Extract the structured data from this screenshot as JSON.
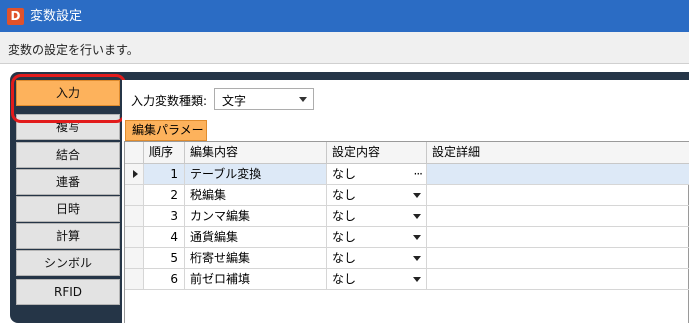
{
  "window": {
    "app_icon_letter": "D",
    "title": "変数設定"
  },
  "message": "変数の設定を行います。",
  "nav": {
    "items": [
      "入力",
      "複写",
      "結合",
      "連番",
      "日時",
      "計算",
      "シンボル",
      "RFID"
    ],
    "active": "入力"
  },
  "input_type": {
    "label": "入力変数種類:",
    "value": "文字"
  },
  "tab_label": "編集パラメータ",
  "grid": {
    "headers": [
      "順序",
      "編集内容",
      "設定内容",
      "設定詳細"
    ],
    "rows": [
      {
        "order": "1",
        "edit": "テーブル変換",
        "setting": "なし",
        "detail": ""
      },
      {
        "order": "2",
        "edit": "税編集",
        "setting": "なし",
        "detail": ""
      },
      {
        "order": "3",
        "edit": "カンマ編集",
        "setting": "なし",
        "detail": ""
      },
      {
        "order": "4",
        "edit": "通貨編集",
        "setting": "なし",
        "detail": ""
      },
      {
        "order": "5",
        "edit": "桁寄せ編集",
        "setting": "なし",
        "detail": ""
      },
      {
        "order": "6",
        "edit": "前ゼロ補填",
        "setting": "なし",
        "detail": ""
      }
    ],
    "ellipsis": "···"
  },
  "colors": {
    "titlebar": "#2b6cc4",
    "accent_orange": "#fdb25c",
    "dark_panel": "#253547",
    "highlight_red": "#e21b1b",
    "selected_row": "#dde9f7"
  }
}
